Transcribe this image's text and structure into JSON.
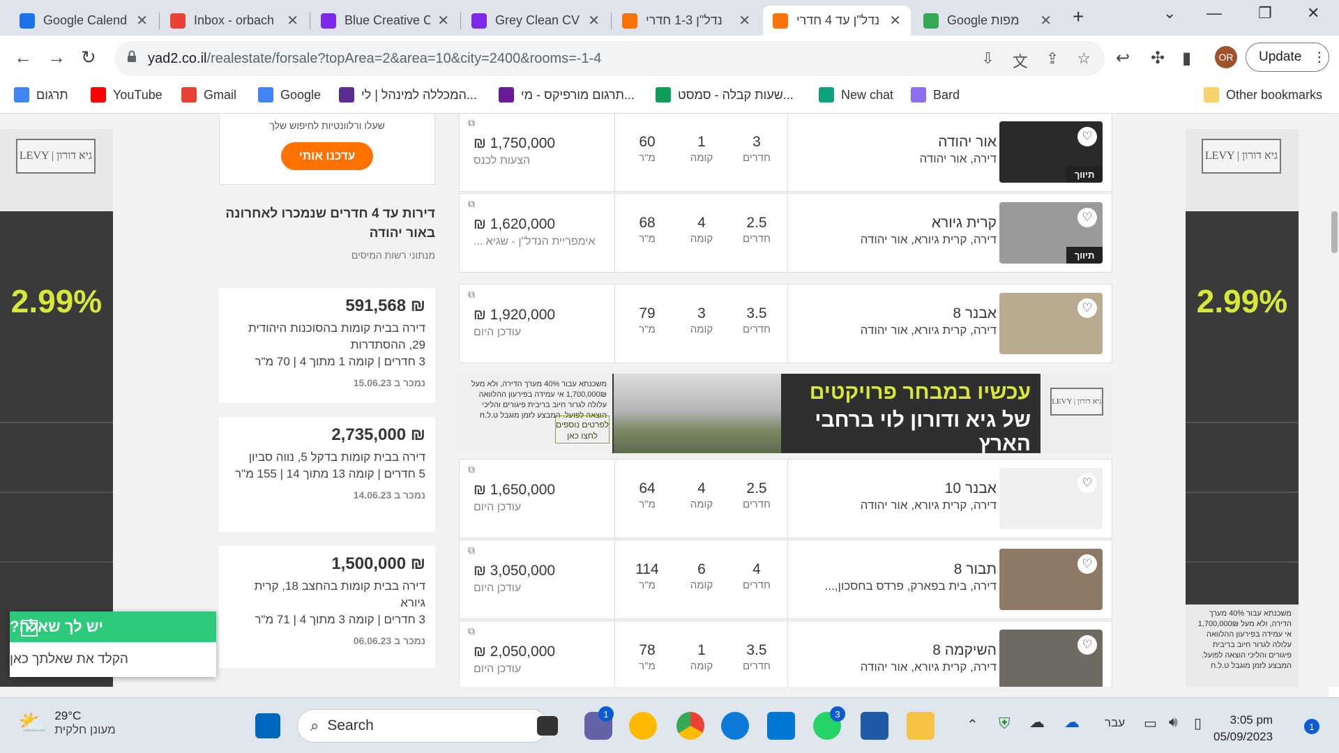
{
  "browser": {
    "tabs": [
      {
        "title": "Google Calend",
        "icon": "google-calendar-icon",
        "color": "#1a73e8"
      },
      {
        "title": "Inbox - orbach",
        "icon": "gmail-icon",
        "color": "#ea4335"
      },
      {
        "title": "Blue Creative C",
        "icon": "canva-icon",
        "color": "#7d2ae8"
      },
      {
        "title": "Grey Clean CV",
        "icon": "canva-icon",
        "color": "#7d2ae8"
      },
      {
        "title": "נדל\"ן 1-3 חדרי",
        "icon": "yad2-icon",
        "color": "#ff7100"
      },
      {
        "title": "נדל\"ן עד 4 חדרי",
        "icon": "yad2-icon",
        "color": "#ff7100",
        "active": true
      },
      {
        "title": "Google מפות",
        "icon": "google-maps-icon",
        "color": "#34a853"
      }
    ],
    "url_host": "yad2.co.il",
    "url_path": "/realestate/forsale?topArea=2&area=10&city=2400&rooms=-1-4",
    "profile_initials": "OR",
    "update_label": "Update",
    "bookmarks": [
      {
        "label": "תרגום",
        "icon": "google-translate-icon",
        "color": "#4285f4"
      },
      {
        "label": "YouTube",
        "icon": "youtube-icon",
        "color": "#ff0000"
      },
      {
        "label": "Gmail",
        "icon": "gmail-icon",
        "color": "#ea4335"
      },
      {
        "label": "Google",
        "icon": "google-icon",
        "color": "#4285f4"
      },
      {
        "label": "המכללה למינהל | לי...",
        "icon": "college-icon",
        "color": "#5c2d91"
      },
      {
        "label": "תרגום מורפיקס - מי...",
        "icon": "morfix-icon",
        "color": "#6a1b9a"
      },
      {
        "label": "שעות קבלה - סמסט...",
        "icon": "plus-icon",
        "color": "#0f9d58"
      },
      {
        "label": "New chat",
        "icon": "chatgpt-icon",
        "color": "#10a37f"
      },
      {
        "label": "Bard",
        "icon": "bard-icon",
        "color": "#8e6cef"
      }
    ],
    "other_bookmarks": "Other bookmarks"
  },
  "ads": {
    "logo_text": "LEVY | גיא דורון",
    "rate": "2.99%",
    "side_bottom_text": "משכנתא עבור 40% מערך הדירה, ולא מעל 1,700,000₪ אי עמידה בפירעון ההלוואה עלולה לגרור חיוב בריבית פיגורים והליכי הוצאה לפועל. המבצע לזמן מוגבל ט.ל.ח",
    "banner_line1": "עכשיו במבחר פרויקטים",
    "banner_line2": "של גיא ודורון לוי ברחבי הארץ",
    "banner_cta": "לפרטים נוספים לחצו כאן",
    "banner_small": "משכנתא עבור 40% מערך הדירה, ולא מעל 1,700,000₪ אי עמידה בפירעון ההלוואה עלולה לגרור חיוב בריבית פיגורים והליכי הוצאה לפועל. המבצע לזמן מוגבל ט.ל.ח"
  },
  "sidebar": {
    "alert_text": "שעלו ורלוונטיות לחיפוש שלך",
    "alert_button": "עדכנו אותי",
    "section_title": "דירות עד 4 חדרים שנמכרו לאחרונה באור יהודה",
    "section_source": "מנתוני רשות המיסים",
    "sold": [
      {
        "price": "₪ 591,568",
        "desc": "דירה בבית קומות בהסוכנות היהודית 29, ההסתדרות",
        "details": "3 חדרים | קומה 1 מתוך 4 | 70 מ\"ר",
        "date": "נמכר ב 15.06.23"
      },
      {
        "price": "₪ 2,735,000",
        "desc": "דירה בבית קומות בדקל 5, נווה סביון",
        "details": "5 חדרים | קומה 13 מתוך 14 | 155 מ\"ר",
        "date": "נמכר ב 14.06.23"
      },
      {
        "price": "₪ 1,500,000",
        "desc": "דירה בבית קומות בהחצב 18, קרית גיורא",
        "details": "3 חדרים | קומה 3 מתוך 4 | 71 מ\"ר",
        "date": "נמכר ב 06.06.23"
      }
    ]
  },
  "labels": {
    "rooms": "חדרים",
    "floor": "קומה",
    "sqm": "מ\"ר",
    "renovated": "תיווך",
    "external": "⧉"
  },
  "listings": [
    {
      "price": "₪ 1,750,000",
      "sub": "הצעות לכנס",
      "sqm": "60",
      "floor": "1",
      "rooms": "3",
      "title": "אור יהודה",
      "address": "דירה, אור יהודה",
      "tag": "תיווך",
      "img": "#2a2a2a"
    },
    {
      "price": "₪ 1,620,000",
      "sub": "אימפריית הנדל\"ן - שגיא ...",
      "sqm": "68",
      "floor": "4",
      "rooms": "2.5",
      "title": "קרית גיורא",
      "address": "דירה, קרית גיורא, אור יהודה",
      "tag": "תיווך",
      "img": "#9a9a9a"
    },
    {
      "price": "₪ 1,920,000",
      "sub": "עודכן היום",
      "sqm": "79",
      "floor": "3",
      "rooms": "3.5",
      "title": "אבנר 8",
      "address": "דירה, קרית גיורא, אור יהודה",
      "tag": "",
      "img": "#b9ab8f"
    },
    {
      "price": "₪ 1,650,000",
      "sub": "עודכן היום",
      "sqm": "64",
      "floor": "4",
      "rooms": "2.5",
      "title": "אבנר 10",
      "address": "דירה, קרית גיורא, אור יהודה",
      "tag": "",
      "img": "#efefef"
    },
    {
      "price": "₪ 3,050,000",
      "sub": "עודכן היום",
      "sqm": "114",
      "floor": "6",
      "rooms": "4",
      "title": "תבור 8",
      "address": "דירה, בית בפארק, פרדס בחסכון,...",
      "tag": "",
      "img": "#8c7a66"
    },
    {
      "price": "₪ 2,050,000",
      "sub": "עודכן היום",
      "sqm": "78",
      "floor": "1",
      "rooms": "3.5",
      "title": "השיקמה 8",
      "address": "דירה, קרית גיורא, אור יהודה",
      "tag": "",
      "img": "#6f6a62"
    }
  ],
  "chat": {
    "title": "יש לך שאלה?",
    "placeholder": "הקלד את שאלתך כאן"
  },
  "taskbar": {
    "temp": "29°C",
    "weather": "מעונן חלקית",
    "search": "Search",
    "lang": "עבר",
    "time": "3:05 pm",
    "date": "05/09/2023",
    "notif": "1",
    "teams_badge": "1",
    "whatsapp_badge": "3"
  }
}
